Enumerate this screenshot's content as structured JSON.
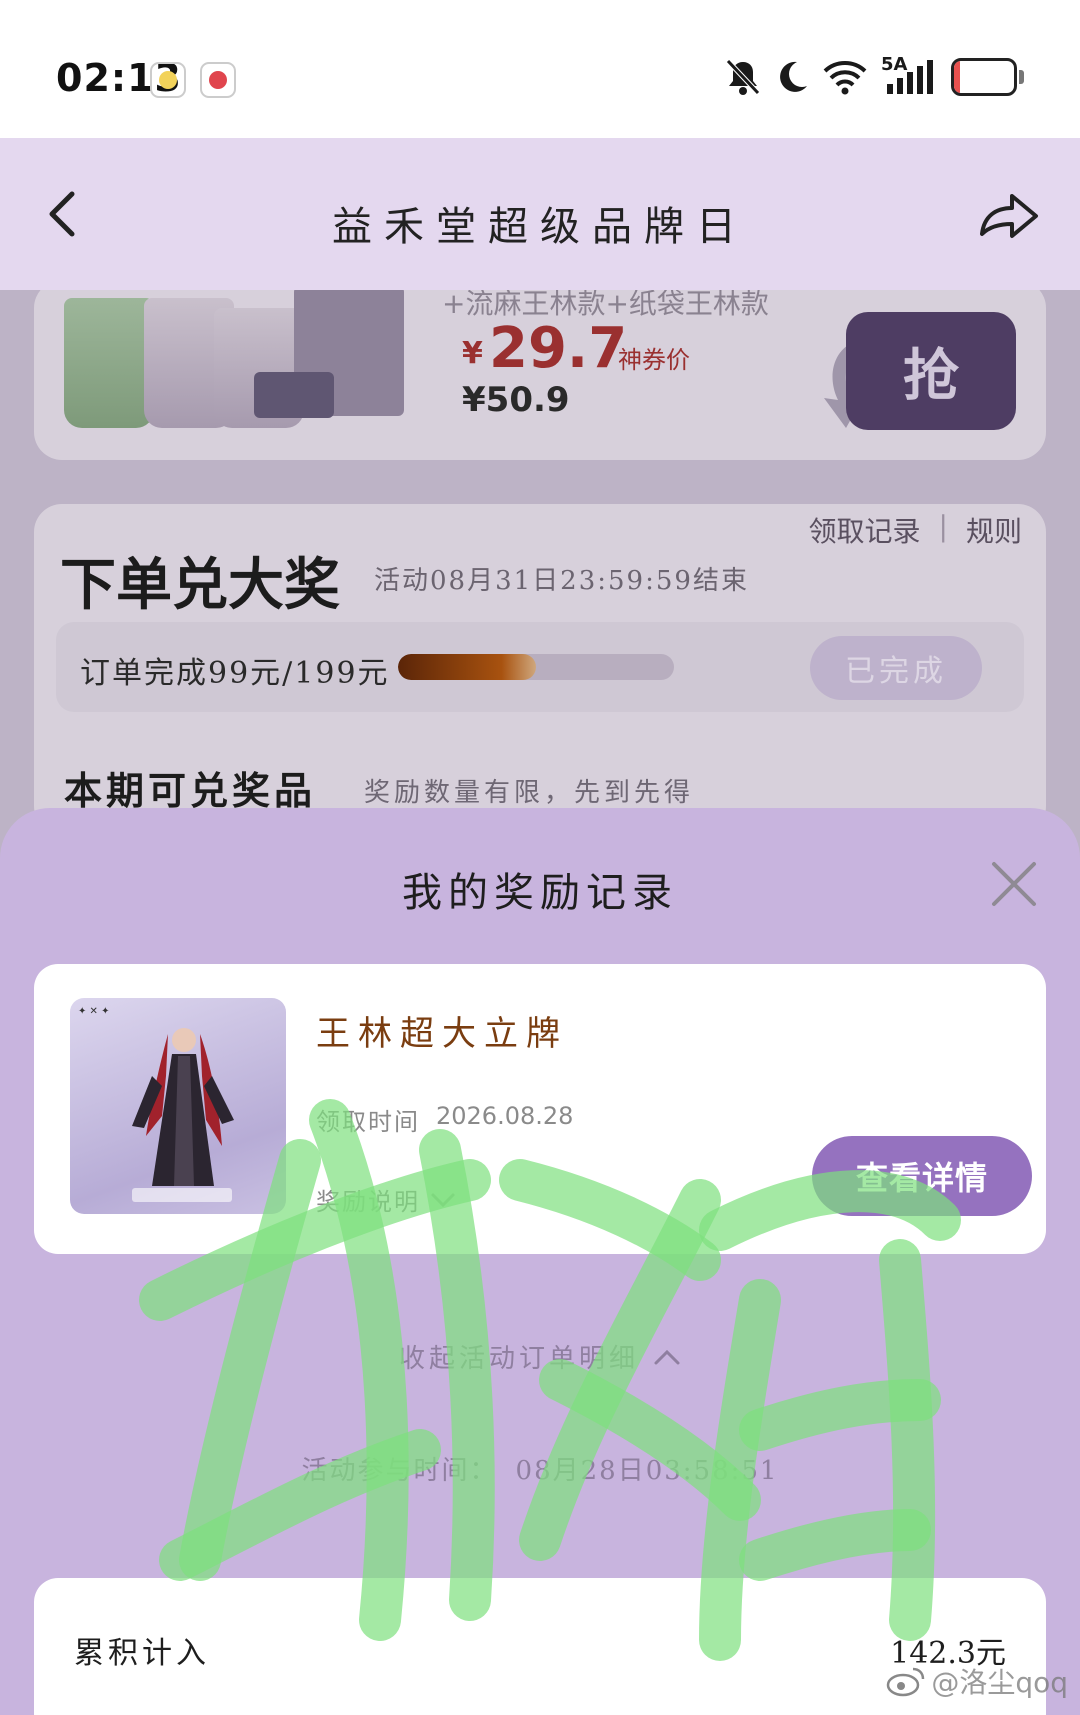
{
  "status_bar": {
    "time": "02:13",
    "network": "5A",
    "battery": "10",
    "battery_level": 0.1
  },
  "header": {
    "title": "益禾堂超级品牌日",
    "back_icon": "chevron-left-icon",
    "share_icon": "share-arrow-icon"
  },
  "background_page": {
    "product": {
      "spec": "+流麻王林款+纸袋王林款",
      "price_symbol": "¥",
      "price": "29.7",
      "price_tag": "神券价",
      "original_price": "¥50.9",
      "grab_label": "抢"
    },
    "reward_section": {
      "records_link": "领取记录",
      "rules_link": "规则",
      "separator": "|",
      "title": "下单兑大奖",
      "period": "活动08月31日23:59:59结束",
      "progress_label": "订单完成99元/199元",
      "progress_fraction": 0.5,
      "done_label": "已完成",
      "prize_title": "本期可兑奖品",
      "prize_note": "奖励数量有限，先到先得"
    }
  },
  "sheet": {
    "title": "我的奖励记录",
    "close_icon": "close-icon",
    "record": {
      "name": "王林超大立牌",
      "time_label": "领取时间",
      "time_value": "2026.08.28",
      "desc_label": "奖励说明",
      "detail_button": "查看详情"
    },
    "collapse_label": "收起活动订单明细",
    "join_time_label": "活动参与时间：",
    "join_time_value": "08月28日03:58:51",
    "total_label": "累积计入",
    "total_value": "142.3元"
  },
  "watermark": "@洛尘qoq",
  "colors": {
    "header_bg": "#e4d8ef",
    "sheet_bg": "#c8b4de",
    "accent_button": "#9572bf",
    "prize_name": "#7a3d10",
    "scribble": "#7ee07e"
  }
}
